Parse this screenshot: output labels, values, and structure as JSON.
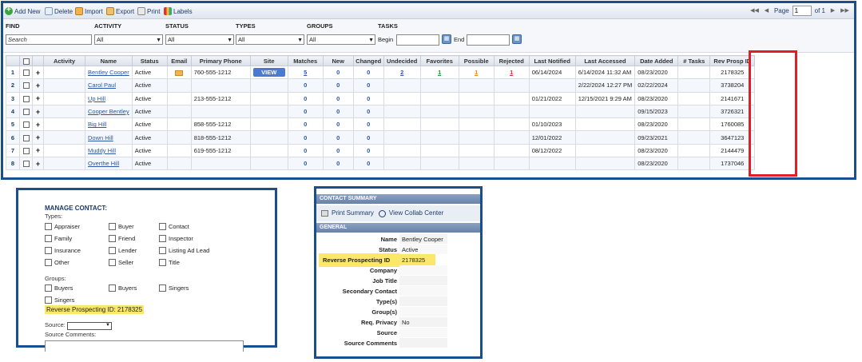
{
  "toolbar": {
    "add": "Add New",
    "delete": "Delete",
    "import": "Import",
    "export": "Export",
    "print": "Print",
    "labels": "Labels",
    "page_label": "Page",
    "page_value": "1",
    "page_of": "of 1"
  },
  "filters": {
    "find": "FIND",
    "search_placeholder": "Search",
    "activity": "ACTIVITY",
    "activity_value": "All",
    "status": "STATUS",
    "status_value": "All",
    "types": "TYPES",
    "types_value": "All",
    "groups": "GROUPS",
    "groups_value": "All",
    "tasks": "TASKS",
    "begin": "Begin",
    "end": "End"
  },
  "grid": {
    "columns": [
      "Activity",
      "Name",
      "Status",
      "Email",
      "Primary Phone",
      "Site",
      "Matches",
      "New",
      "Changed",
      "Undecided",
      "Favorites",
      "Possible",
      "Rejected",
      "Last Notified",
      "Last Accessed",
      "Date Added",
      "# Tasks",
      "Rev Prosp ID"
    ],
    "view_label": "VIEW",
    "rows": [
      {
        "n": "1",
        "name": "Bentley Cooper",
        "status": "Active",
        "email": true,
        "phone": "760-555-1212",
        "site": true,
        "matches": "5",
        "new": "0",
        "changed": "0",
        "undecided": "2",
        "favorites": "1",
        "possible": "1",
        "rejected": "1",
        "notified": "06/14/2024",
        "accessed": "6/14/2024 11:32 AM",
        "added": "08/23/2020",
        "tasks": "",
        "rpid": "2178325"
      },
      {
        "n": "2",
        "name": "Carol Paul",
        "status": "Active",
        "email": false,
        "phone": "",
        "site": false,
        "matches": "0",
        "new": "0",
        "changed": "0",
        "undecided": "",
        "favorites": "",
        "possible": "",
        "rejected": "",
        "notified": "",
        "accessed": "2/22/2024 12:27 PM",
        "added": "02/22/2024",
        "tasks": "",
        "rpid": "3738204"
      },
      {
        "n": "3",
        "name": "Up Hill",
        "status": "Active",
        "email": false,
        "phone": "213-555-1212",
        "site": false,
        "matches": "0",
        "new": "0",
        "changed": "0",
        "undecided": "",
        "favorites": "",
        "possible": "",
        "rejected": "",
        "notified": "01/21/2022",
        "accessed": "12/15/2021 9:29 AM",
        "added": "08/23/2020",
        "tasks": "",
        "rpid": "2141671"
      },
      {
        "n": "4",
        "name": "Cooper Bentley",
        "status": "Active",
        "email": false,
        "phone": "",
        "site": false,
        "matches": "0",
        "new": "0",
        "changed": "0",
        "undecided": "",
        "favorites": "",
        "possible": "",
        "rejected": "",
        "notified": "",
        "accessed": "",
        "added": "09/15/2023",
        "tasks": "",
        "rpid": "3726321"
      },
      {
        "n": "5",
        "name": "Big Hill",
        "status": "Active",
        "email": false,
        "phone": "858-555-1212",
        "site": false,
        "matches": "0",
        "new": "0",
        "changed": "0",
        "undecided": "",
        "favorites": "",
        "possible": "",
        "rejected": "",
        "notified": "01/10/2023",
        "accessed": "",
        "added": "08/23/2020",
        "tasks": "",
        "rpid": "1760085"
      },
      {
        "n": "6",
        "name": "Down Hill",
        "status": "Active",
        "email": false,
        "phone": "818-555-1212",
        "site": false,
        "matches": "0",
        "new": "0",
        "changed": "0",
        "undecided": "",
        "favorites": "",
        "possible": "",
        "rejected": "",
        "notified": "12/01/2022",
        "accessed": "",
        "added": "09/23/2021",
        "tasks": "",
        "rpid": "3647123"
      },
      {
        "n": "7",
        "name": "Muddy Hill",
        "status": "Active",
        "email": false,
        "phone": "619-555-1212",
        "site": false,
        "matches": "0",
        "new": "0",
        "changed": "0",
        "undecided": "",
        "favorites": "",
        "possible": "",
        "rejected": "",
        "notified": "08/12/2022",
        "accessed": "",
        "added": "08/23/2020",
        "tasks": "",
        "rpid": "2144479"
      },
      {
        "n": "8",
        "name": "Overthe Hill",
        "status": "Active",
        "email": false,
        "phone": "",
        "site": false,
        "matches": "0",
        "new": "0",
        "changed": "0",
        "undecided": "",
        "favorites": "",
        "possible": "",
        "rejected": "",
        "notified": "",
        "accessed": "",
        "added": "08/23/2020",
        "tasks": "",
        "rpid": "1737046"
      }
    ]
  },
  "manage": {
    "title": "MANAGE CONTACT:",
    "types_label": "Types:",
    "types": [
      "Appraiser",
      "Buyer",
      "Contact",
      "Family",
      "Friend",
      "Inspector",
      "Insurance",
      "Lender",
      "Listing Ad Lead",
      "Other",
      "Seller",
      "Title"
    ],
    "groups_label": "Groups:",
    "groups": [
      "Buyers",
      "Buyers",
      "Singers",
      "Singers"
    ],
    "rpid": "Reverse Prospecting ID: 2178325",
    "source": "Source:",
    "source_comments": "Source Comments:"
  },
  "summary": {
    "header": "CONTACT SUMMARY",
    "print": "Print Summary",
    "collab": "View Collab Center",
    "general": "GENERAL",
    "fields": [
      {
        "k": "Name",
        "v": "Bentley Cooper"
      },
      {
        "k": "Status",
        "v": "Active"
      },
      {
        "k": "Reverse Prospecting ID",
        "v": "2178325"
      },
      {
        "k": "Company",
        "v": ""
      },
      {
        "k": "Job Title",
        "v": ""
      },
      {
        "k": "Secondary Contact",
        "v": ""
      },
      {
        "k": "Type(s)",
        "v": ""
      },
      {
        "k": "Group(s)",
        "v": ""
      },
      {
        "k": "Req. Privacy",
        "v": "No"
      },
      {
        "k": "Source",
        "v": ""
      },
      {
        "k": "Source Comments",
        "v": ""
      }
    ]
  },
  "colors": {
    "frame": "#1a4f8f",
    "highlight_box": "#e01e26",
    "highlight_fill": "#fbe76b"
  }
}
